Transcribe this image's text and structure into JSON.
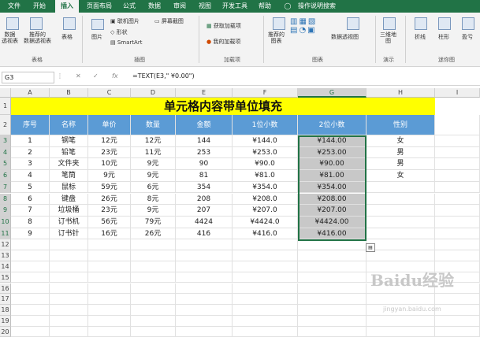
{
  "tabs": [
    "文件",
    "开始",
    "插入",
    "页面布局",
    "公式",
    "数据",
    "审阅",
    "视图",
    "开发工具",
    "帮助",
    "操作说明搜索"
  ],
  "ribbon": {
    "items": [
      "数据\n透视表",
      "推荐的\n数据透视表",
      "表格",
      "图片",
      "联机图片",
      "形状",
      "SmartArt",
      "屏幕截图",
      "获取加载项",
      "我的加载项",
      "推荐的\n图表",
      "数据透视图",
      "三维地\n图",
      "折线",
      "柱形",
      "盈亏"
    ],
    "groups": [
      "表格",
      "插图",
      "加载项",
      "图表",
      "演示",
      "迷你图"
    ]
  },
  "formula_bar": {
    "name_box": "G3",
    "formula": "=TEXT(E3,\" ¥0.00\")"
  },
  "columns": [
    "A",
    "B",
    "C",
    "D",
    "E",
    "F",
    "G",
    "H",
    "I"
  ],
  "rows": [
    "1",
    "2",
    "3",
    "4",
    "5",
    "6",
    "7",
    "8",
    "9",
    "10",
    "11",
    "12",
    "13",
    "14",
    "15",
    "16",
    "17",
    "18",
    "19",
    "20"
  ],
  "title": "单元格内容带单位填充",
  "headers": [
    "序号",
    "名称",
    "单价",
    "数量",
    "金额",
    "1位小数",
    "2位小数",
    "性别"
  ],
  "data": [
    [
      "1",
      "钢笔",
      "12元",
      "12元",
      "144",
      "¥144.0",
      "¥144.00",
      "女"
    ],
    [
      "2",
      "铅笔",
      "23元",
      "11元",
      "253",
      "¥253.0",
      "¥253.00",
      "男"
    ],
    [
      "3",
      "文件夹",
      "10元",
      "9元",
      "90",
      "¥90.0",
      "¥90.00",
      "男"
    ],
    [
      "4",
      "笔筒",
      "9元",
      "9元",
      "81",
      "¥81.0",
      "¥81.00",
      "女"
    ],
    [
      "5",
      "鼠标",
      "59元",
      "6元",
      "354",
      "¥354.0",
      "¥354.00",
      ""
    ],
    [
      "6",
      "键盘",
      "26元",
      "8元",
      "208",
      "¥208.0",
      "¥208.00",
      ""
    ],
    [
      "7",
      "垃圾桶",
      "23元",
      "9元",
      "207",
      "¥207.0",
      "¥207.00",
      ""
    ],
    [
      "8",
      "订书机",
      "56元",
      "79元",
      "4424",
      "¥4424.0",
      "¥4424.00",
      ""
    ],
    [
      "9",
      "订书针",
      "16元",
      "26元",
      "416",
      "¥416.0",
      "¥416.00",
      ""
    ]
  ],
  "watermark": "Baidu经验",
  "watermark_url": "jingyan.baidu.com",
  "colors": {
    "excel_green": "#217346",
    "title_fill": "#ffff00",
    "header_fill": "#5b9bd5",
    "selection_fill": "#c8c8c8"
  }
}
